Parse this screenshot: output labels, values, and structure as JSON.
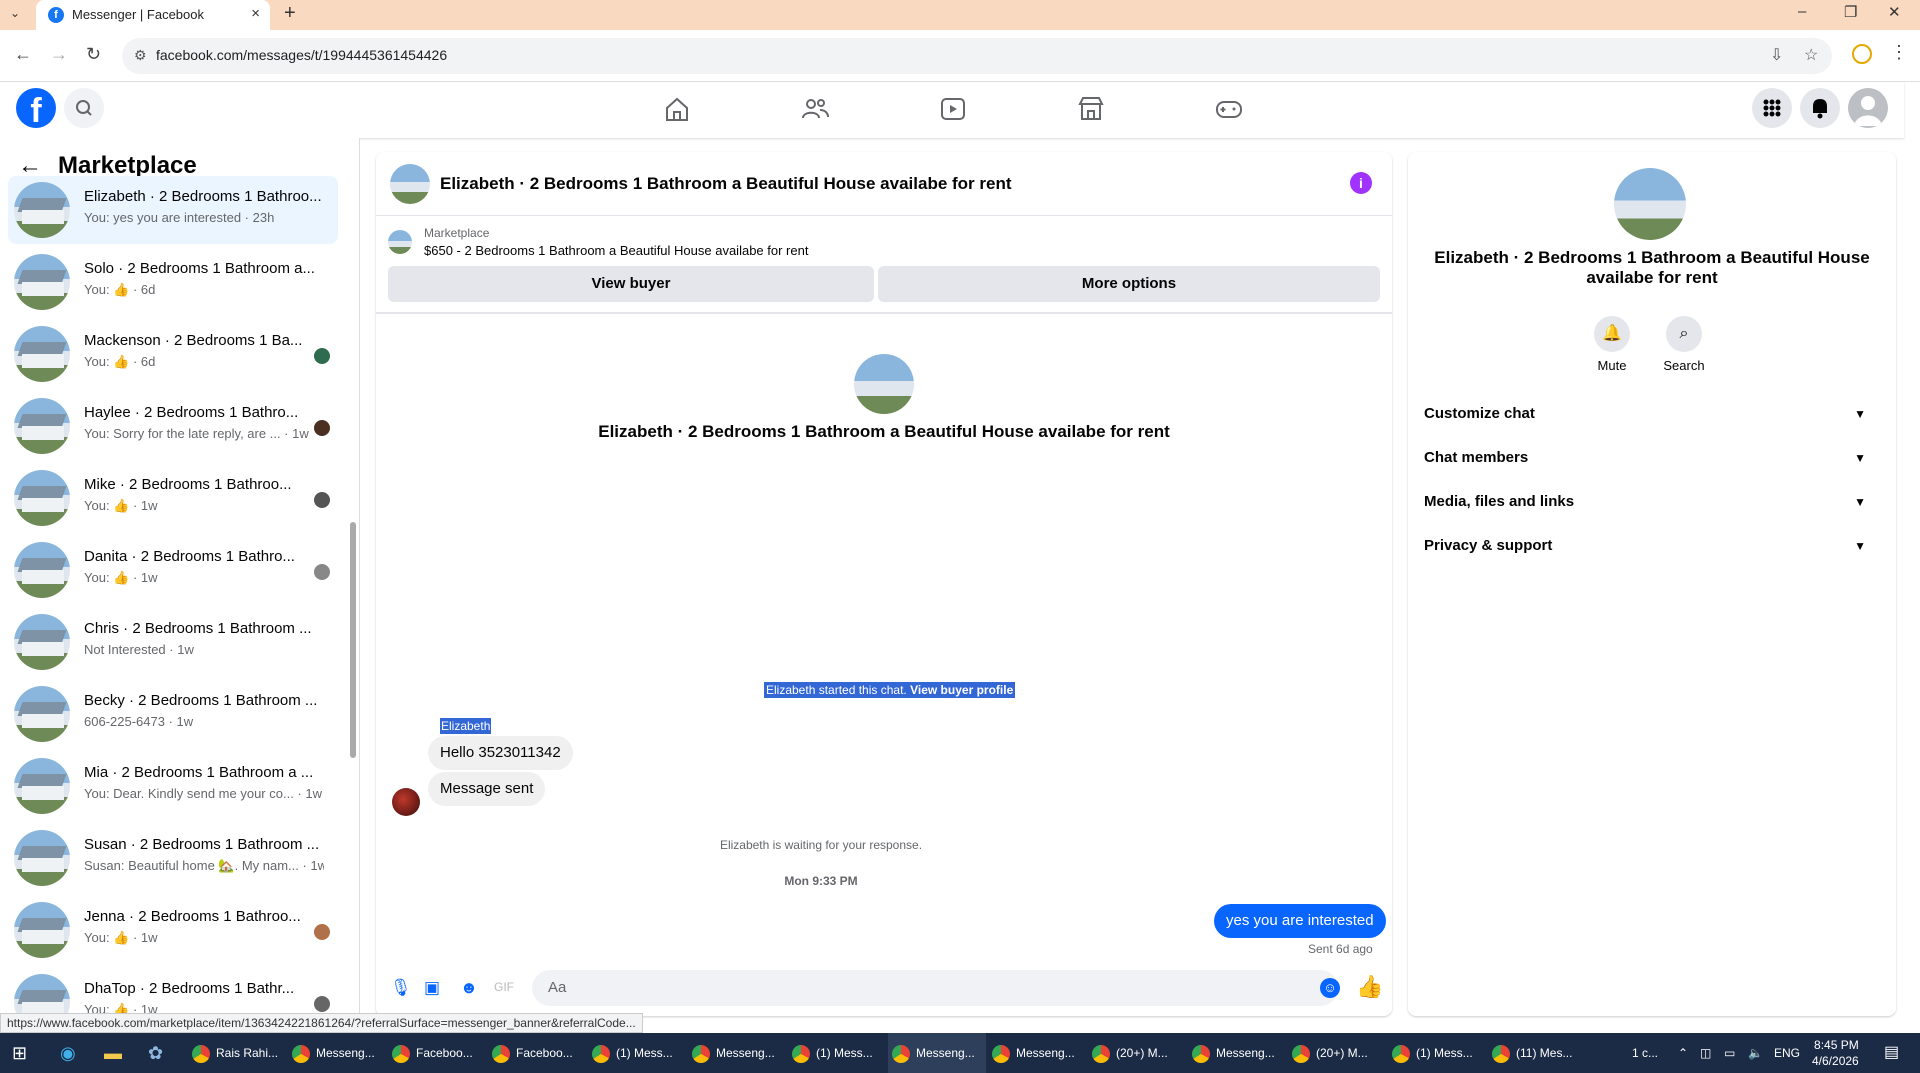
{
  "browser": {
    "tab_title": "Messenger | Facebook",
    "url": "facebook.com/messages/t/1994445361454426",
    "status_url": "https://www.facebook.com/marketplace/item/1363424221861264/?referralSurface=messenger_banner&referralCode..."
  },
  "sidebar": {
    "title": "Marketplace",
    "conversations": [
      {
        "name": "Elizabeth · 2 Bedrooms 1 Bathroo...",
        "sub": "You: yes you are interested · 23h"
      },
      {
        "name": "Solo · 2 Bedrooms 1 Bathroom a...",
        "sub": "You: 👍 · 6d"
      },
      {
        "name": "Mackenson · 2 Bedrooms 1 Ba...",
        "sub": "You: 👍 · 6d"
      },
      {
        "name": "Haylee · 2 Bedrooms 1 Bathro...",
        "sub": "You: Sorry for the late reply, are ... · 1w"
      },
      {
        "name": "Mike · 2 Bedrooms 1 Bathroo...",
        "sub": "You: 👍 · 1w"
      },
      {
        "name": "Danita · 2 Bedrooms 1 Bathro...",
        "sub": "You: 👍 · 1w"
      },
      {
        "name": "Chris · 2 Bedrooms 1 Bathroom ...",
        "sub": "Not Interested · 1w"
      },
      {
        "name": "Becky · 2 Bedrooms 1 Bathroom ...",
        "sub": "606-225-6473 · 1w"
      },
      {
        "name": "Mia · 2 Bedrooms 1 Bathroom a ...",
        "sub": "You: Dear. Kindly send me your co... · 1w"
      },
      {
        "name": "Susan · 2 Bedrooms 1 Bathroom ...",
        "sub": "Susan: Beautiful home 🏡. My nam... · 1w"
      },
      {
        "name": "Jenna · 2 Bedrooms 1 Bathroo...",
        "sub": "You: 👍 · 1w"
      },
      {
        "name": "DhaTop · 2 Bedrooms 1 Bathr...",
        "sub": "You: 👍 · 1w"
      }
    ]
  },
  "chat": {
    "title": "Elizabeth · 2 Bedrooms 1 Bathroom a Beautiful House availabe for rent",
    "marketplace_label": "Marketplace",
    "listing": "$650 - 2 Bedrooms 1 Bathroom a Beautiful House availabe for rent",
    "view_buyer": "View buyer",
    "more_options": "More options",
    "center_title": "Elizabeth · 2 Bedrooms 1 Bathroom a Beautiful House availabe for rent",
    "started_text": "Elizabeth started this chat.",
    "view_profile": "View buyer profile",
    "sender": "Elizabeth",
    "msg1": "Hello 3523011342",
    "msg2": "Message sent",
    "waiting": "Elizabeth is waiting for your response.",
    "time": "Mon 9:33 PM",
    "outgoing": "yes you are interested",
    "sent": "Sent 6d ago",
    "placeholder": "Aa"
  },
  "details": {
    "title": "Elizabeth · 2 Bedrooms 1 Bathroom a Beautiful House availabe for rent",
    "mute": "Mute",
    "search": "Search",
    "sections": [
      "Customize chat",
      "Chat members",
      "Media, files and links",
      "Privacy & support"
    ]
  },
  "taskbar": {
    "items": [
      "Rais Rahi...",
      "Messeng...",
      "Faceboo...",
      "Faceboo...",
      "(1) Mess...",
      "Messeng...",
      "(1) Mess...",
      "Messeng...",
      "Messeng...",
      "(20+) M...",
      "Messeng...",
      "(20+) M...",
      "(1) Mess...",
      "(11) Mes..."
    ],
    "tray_count": "1 c...",
    "lang": "ENG",
    "time": "8:45 PM",
    "date": "4/6/2026"
  },
  "colors": {
    "accent": "#0866ff",
    "info": "#a033ff",
    "selection": "#3367d6"
  }
}
